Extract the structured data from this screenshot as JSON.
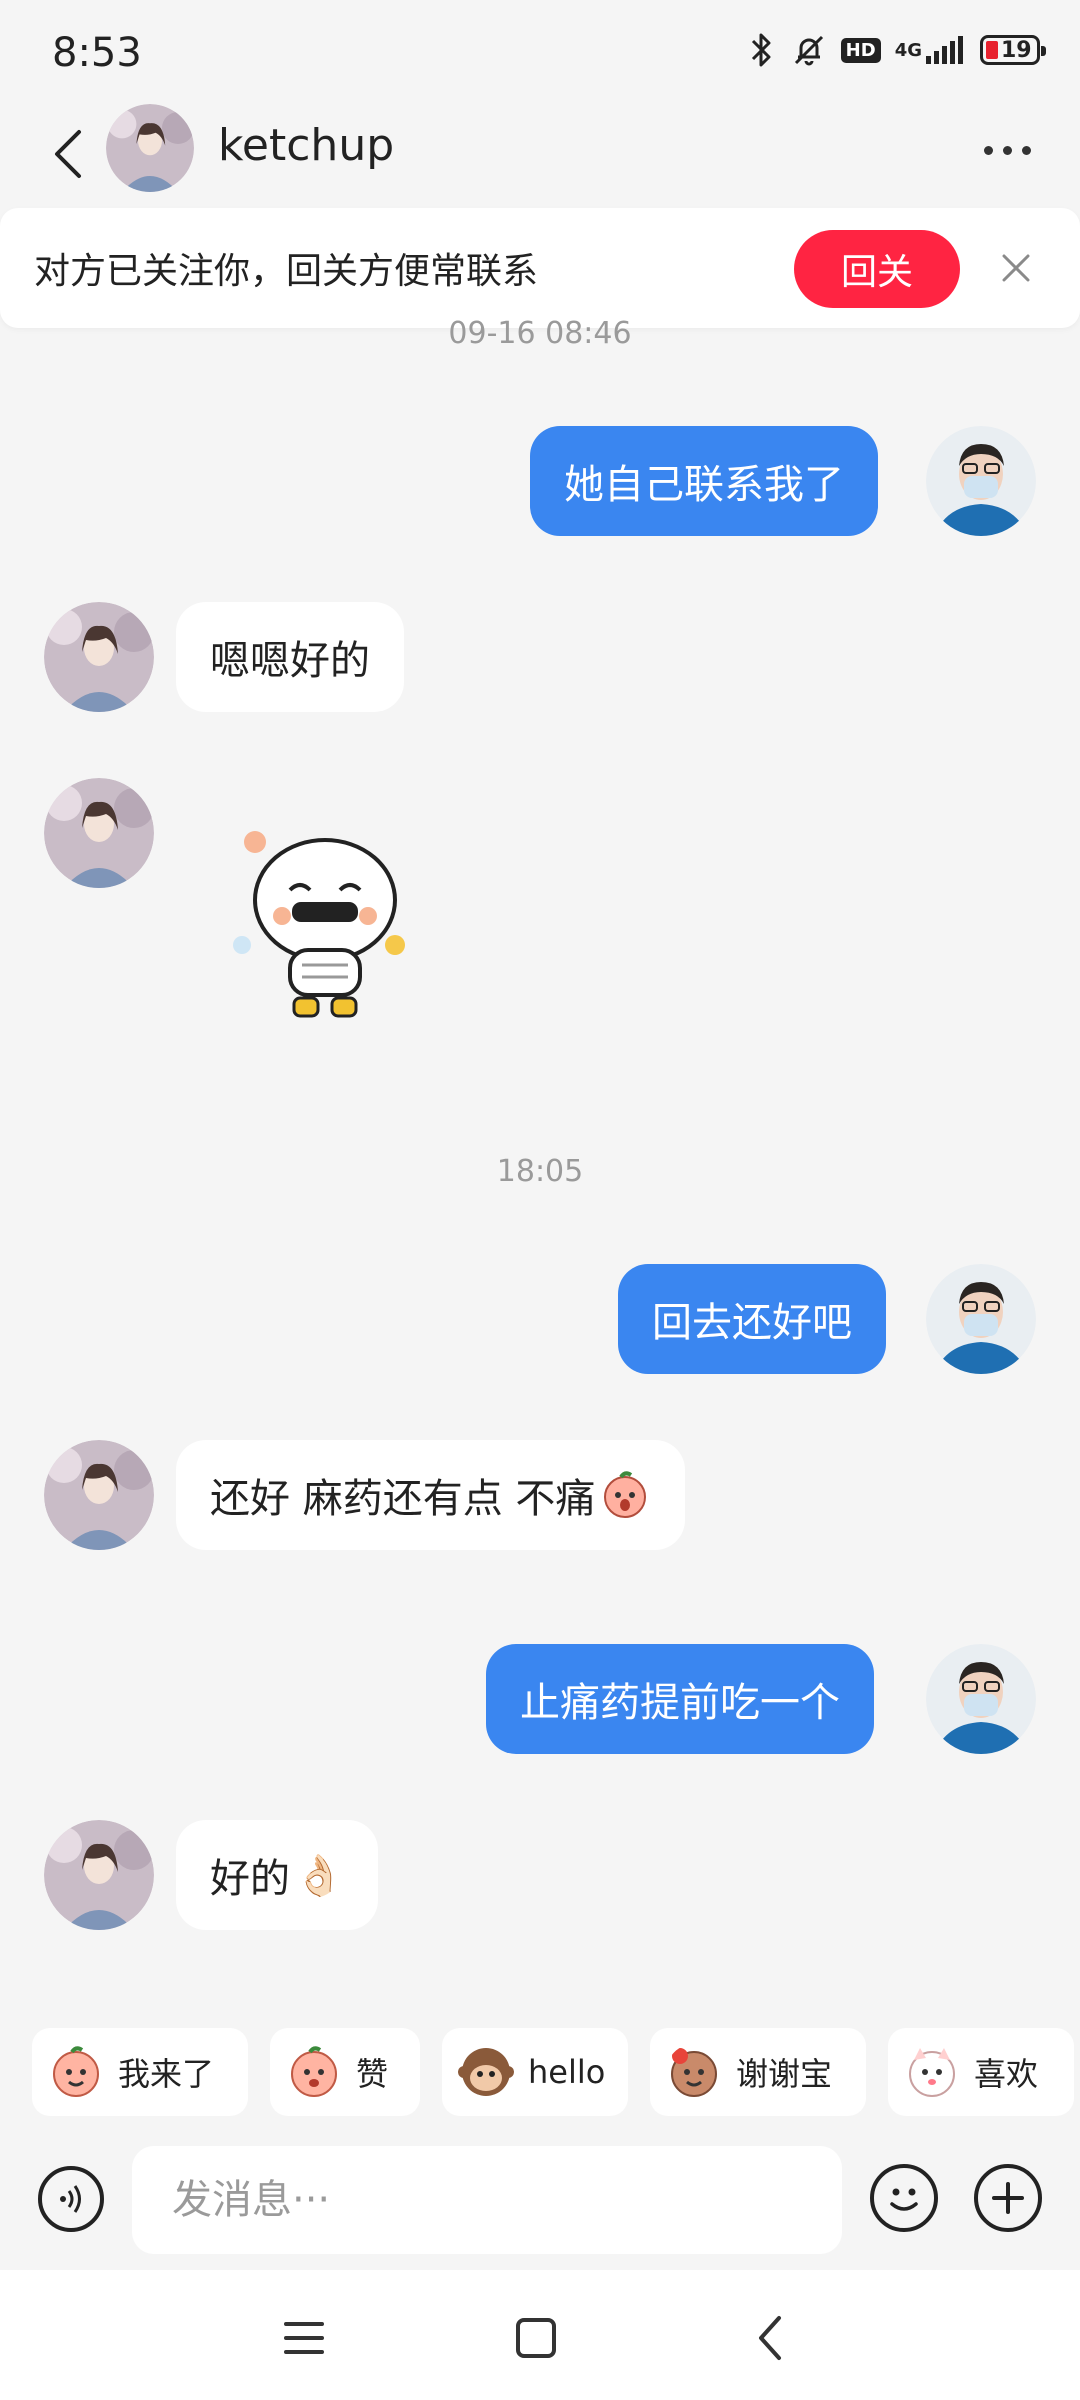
{
  "status_bar": {
    "time": "8:53",
    "network_label": "4G",
    "hd_label": "HD",
    "battery_level": "19",
    "battery_color": "#e8212e",
    "icons": [
      "bluetooth-icon",
      "bell-muted-icon",
      "hd-icon",
      "signal-icon",
      "battery-icon"
    ]
  },
  "header": {
    "contact_name": "ketchup",
    "back_icon": "chevron-left-icon",
    "more_icon": "more-dots-icon"
  },
  "follow_banner": {
    "text": "对方已关注你，回关方便常联系",
    "button_label": "回关",
    "button_color": "#ff2442",
    "close_icon": "close-icon"
  },
  "messages": {
    "timestamp_1": "09-16 08:46",
    "m1": "她自己联系我了",
    "m2": "嗯嗯好的",
    "m3_sticker": "sticker-image",
    "timestamp_2": "18:05",
    "m4": "回去还好吧",
    "m5": "还好 麻药还有点 不痛",
    "m6": "止痛药提前吃一个",
    "m7": "好的",
    "m7_emoji": "👌🏻",
    "me_bubble_color": "#3a86f0",
    "them_bubble_color": "#ffffff"
  },
  "quick_replies": [
    {
      "label": "我来了",
      "emoji": "peach-emoji-icon"
    },
    {
      "label": "赞",
      "emoji": "peach-emoji-icon"
    },
    {
      "label": "hello",
      "emoji": "monkey-emoji-icon"
    },
    {
      "label": "谢谢宝",
      "emoji": "peach-emoji-icon"
    },
    {
      "label": "喜欢",
      "emoji": "cat-emoji-icon"
    }
  ],
  "input_bar": {
    "placeholder": "发消息···",
    "value": "",
    "voice_icon": "voice-icon",
    "emoji_icon": "smiley-icon",
    "plus_icon": "plus-icon"
  },
  "nav_bar": {
    "icons": [
      "menu-icon",
      "home-icon",
      "back-icon"
    ]
  }
}
